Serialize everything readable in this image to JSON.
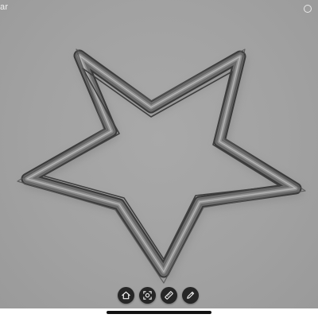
{
  "window": {
    "title_fragment": "ar"
  },
  "viewer": {
    "model_name": "star-cookie-cutter",
    "background_color": "#a4a4a4",
    "model_color": "#5e5e5e"
  },
  "toolbar": {
    "buttons": [
      {
        "name": "home",
        "icon": "home-icon"
      },
      {
        "name": "fit-view",
        "icon": "fit-view-icon"
      },
      {
        "name": "measure",
        "icon": "ruler-icon"
      },
      {
        "name": "annotate",
        "icon": "pencil-icon"
      }
    ]
  }
}
